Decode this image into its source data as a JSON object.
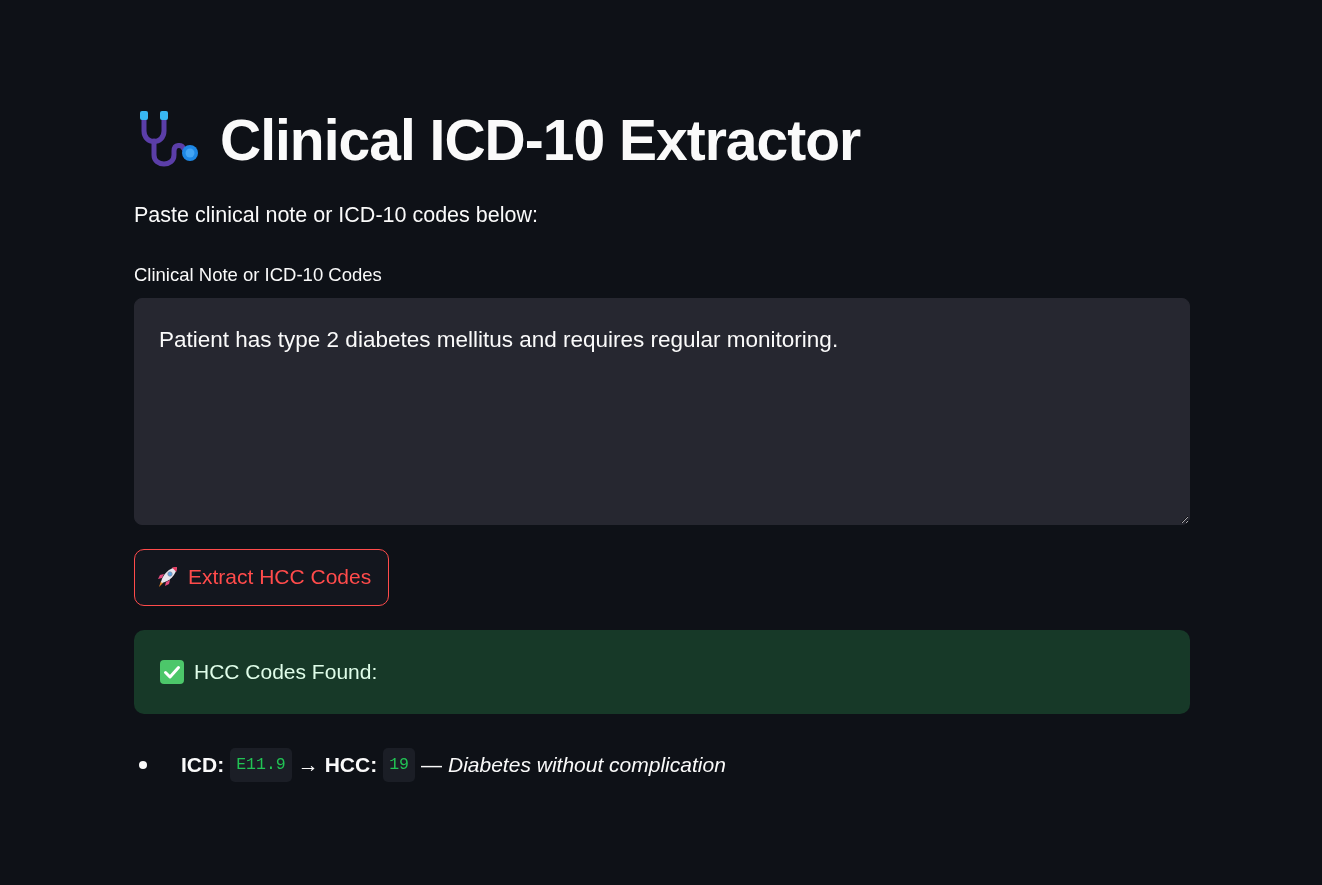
{
  "header": {
    "title": "Clinical ICD-10 Extractor"
  },
  "intro": "Paste clinical note or ICD-10 codes below:",
  "note_field": {
    "label": "Clinical Note or ICD-10 Codes",
    "value": "Patient has type 2 diabetes mellitus and requires regular monitoring."
  },
  "extract_button": {
    "label": "Extract HCC Codes"
  },
  "alert": {
    "kind": "success",
    "text": "HCC Codes Found:"
  },
  "results": [
    {
      "icd_label": "ICD:",
      "icd_code": "E11.9",
      "arrow": "→",
      "hcc_label": "HCC:",
      "hcc_code": "19",
      "separator": "—",
      "description": "Diabetes without complication"
    }
  ]
}
